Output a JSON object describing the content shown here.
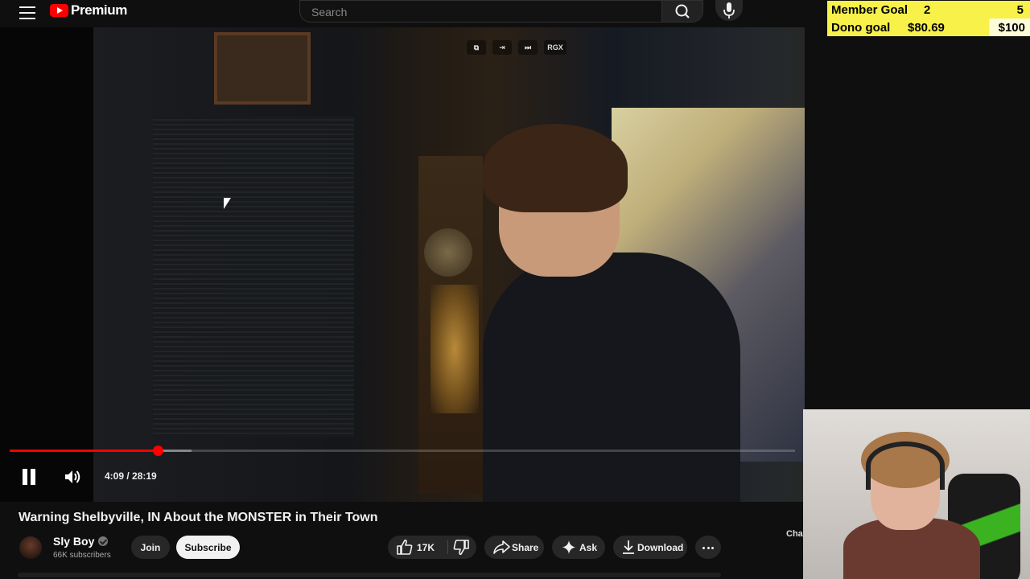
{
  "header": {
    "logo_text": "Premium",
    "search_placeholder": "Search"
  },
  "goals": {
    "member_label": "Member Goal",
    "member_current": "2",
    "member_target": "5",
    "dono_label": "Dono goal",
    "dono_current": "$80.69",
    "dono_target": "$100",
    "dono_progress": 0.807
  },
  "player": {
    "tools": [
      "⧉",
      "⇥",
      "⏭",
      "RGX"
    ],
    "time": "4:09 / 28:19",
    "played_fraction": 0.189,
    "buffer_fraction": 0.232
  },
  "video": {
    "title": "Warning Shelbyville, IN About the MONSTER in Their Town",
    "channel": "Sly Boy",
    "subscribers": "66K subscribers",
    "join_label": "Join",
    "subscribe_label": "Subscribe",
    "likes": "17K",
    "share_label": "Share",
    "ask_label": "Ask",
    "download_label": "Download",
    "chat_label": "Cha"
  },
  "colors": {
    "accent": "#ff0000",
    "goal_bar": "#f7f14a",
    "background": "#0f0f0f"
  }
}
